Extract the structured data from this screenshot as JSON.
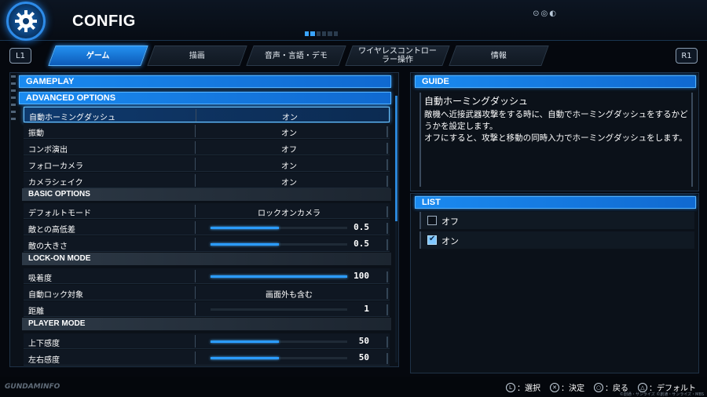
{
  "header": {
    "title": "CONFIG",
    "deco": "⊙◎◐"
  },
  "tabs": {
    "left_button": "L1",
    "right_button": "R1",
    "items": [
      {
        "label": "ゲーム",
        "active": true
      },
      {
        "label": "描画",
        "active": false
      },
      {
        "label": "音声・言語・デモ",
        "active": false
      },
      {
        "label": "ワイヤレスコントローラー操作",
        "active": false
      },
      {
        "label": "情報",
        "active": false
      }
    ]
  },
  "settings": {
    "section_title": "GAMEPLAY",
    "advanced": {
      "title": "ADVANCED OPTIONS",
      "rows": [
        {
          "label": "自動ホーミングダッシュ",
          "value": "オン"
        },
        {
          "label": "振動",
          "value": "オン"
        },
        {
          "label": "コンボ演出",
          "value": "オフ"
        },
        {
          "label": "フォローカメラ",
          "value": "オン"
        },
        {
          "label": "カメラシェイク",
          "value": "オン"
        }
      ]
    },
    "basic": {
      "title": "BASIC OPTIONS",
      "rows": [
        {
          "label": "デフォルトモード",
          "value": "ロックオンカメラ"
        },
        {
          "label": "敵との高低差",
          "value": "0.5",
          "level": 0.5
        },
        {
          "label": "敵の大きさ",
          "value": "0.5",
          "level": 0.5
        }
      ]
    },
    "lockon": {
      "title": "LOCK-ON MODE",
      "rows": [
        {
          "label": "吸着度",
          "value": "100",
          "level": 1.0
        },
        {
          "label": "自動ロック対象",
          "value": "画面外も含む"
        },
        {
          "label": "距離",
          "value": "1",
          "level": 0.0
        }
      ]
    },
    "player": {
      "title": "PLAYER MODE",
      "rows": [
        {
          "label": "上下感度",
          "value": "50",
          "level": 0.5
        },
        {
          "label": "左右感度",
          "value": "50",
          "level": 0.5
        }
      ]
    }
  },
  "guide": {
    "title": "GUIDE",
    "heading": "自動ホーミングダッシュ",
    "body": "敵機へ近接武器攻撃をする時に、自動でホーミングダッシュをするかどうかを設定します。\nオフにすると、攻撃と移動の同時入力でホーミングダッシュをします。"
  },
  "list": {
    "title": "LIST",
    "options": [
      {
        "label": "オフ",
        "checked": false
      },
      {
        "label": "オン",
        "checked": true
      }
    ]
  },
  "footer": {
    "logo": "GUNDAMINFO",
    "hints": [
      {
        "glyph": "L",
        "label": "：選択"
      },
      {
        "glyph": "✕",
        "label": "：決定"
      },
      {
        "glyph": "○",
        "label": "：戻る"
      },
      {
        "glyph": "△",
        "label": "：デフォルト"
      }
    ],
    "copyright": "©創通・サンライズ ©創通・サンライズ・MBS"
  },
  "colors": {
    "accent": "#1a8af0",
    "slider_fill": "#2b9cff",
    "selected_row": "#0f3a6e",
    "panel_bg": "#0b1119"
  }
}
